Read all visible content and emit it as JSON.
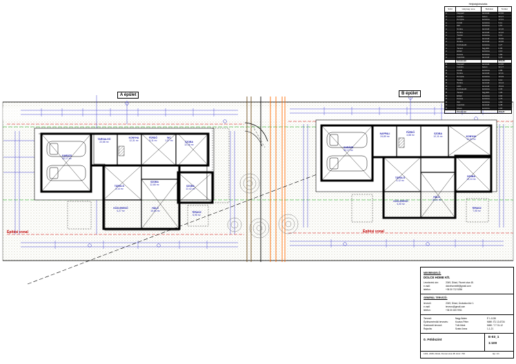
{
  "buildings": {
    "a_label": "A épület",
    "b_label": "B épület",
    "zone_a": "Építési vonal",
    "zone_b": "Építési vonal"
  },
  "rooms_a": [
    {
      "name": "TARSALGÓ",
      "area": "22,66 m²"
    },
    {
      "name": "GARÁZS",
      "area": "32,17 m²"
    },
    {
      "name": "KONYHA",
      "area": "12,31 m²"
    },
    {
      "name": "FÜRDŐ",
      "area": "5,11 m²"
    },
    {
      "name": "WC",
      "area": "1,57 m²"
    },
    {
      "name": "SZOBA",
      "area": "12,16 m²"
    },
    {
      "name": "SZOBA",
      "area": "12,42 m²"
    },
    {
      "name": "TÁROLÓ",
      "area": "3,14 m²"
    },
    {
      "name": "HÁLÓ",
      "area": "15,56 m²"
    },
    {
      "name": "SZOBA",
      "area": "12,66 m²"
    },
    {
      "name": "KÖZLEKEDŐ",
      "area": "4,27 m²"
    },
    {
      "name": "TERASZ",
      "area": "6,95 m²"
    }
  ],
  "rooms_b": [
    {
      "name": "NAPPALI",
      "area": "24,80 m²"
    },
    {
      "name": "GARÁZS",
      "area": "32,17 m²"
    },
    {
      "name": "FÜRDŐ",
      "area": "4,88 m²"
    },
    {
      "name": "SZOBA",
      "area": "12,11 m²"
    },
    {
      "name": "KONYHA",
      "area": "12,04 m²"
    },
    {
      "name": "TÁROLÓ",
      "area": "3,12 m²"
    },
    {
      "name": "SZOBA",
      "area": "13,14 m²"
    },
    {
      "name": "HÁLÓ",
      "area": "15,04 m²"
    },
    {
      "name": "KÖZLEKEDŐ",
      "area": "4,30 m²"
    },
    {
      "name": "TERASZ",
      "area": "7,05 m²"
    }
  ],
  "summary": {
    "title": "Helyiségkimutatás",
    "headers": [
      "Szint",
      "Helyiség neve",
      "Burkolat",
      "Terület"
    ],
    "rows_a": [
      [
        "A",
        "Nappali",
        "laminált",
        "22,66"
      ],
      [
        "A",
        "Garázs",
        "beton",
        "32,17"
      ],
      [
        "A",
        "Konyha",
        "kerámia",
        "12,31"
      ],
      [
        "A",
        "Fürdő",
        "kerámia",
        "5,11"
      ],
      [
        "A",
        "WC",
        "kerámia",
        "1,57"
      ],
      [
        "A",
        "Szoba",
        "laminált",
        "12,16"
      ],
      [
        "A",
        "Szoba",
        "laminált",
        "12,42"
      ],
      [
        "A",
        "Tároló",
        "kerámia",
        "3,14"
      ],
      [
        "A",
        "Háló",
        "laminált",
        "15,56"
      ],
      [
        "A",
        "Szoba",
        "laminált",
        "12,66"
      ],
      [
        "A",
        "Közlekedő",
        "kerámia",
        "4,27"
      ],
      [
        "A",
        "Terasz",
        "fagyálló",
        "6,95"
      ],
      [
        "A",
        "Előtér",
        "kerámia",
        "4,10"
      ],
      [
        "A",
        "Kamra",
        "kerámia",
        "1,82"
      ],
      [
        "A",
        "Gardrób",
        "laminált",
        "3,40"
      ]
    ],
    "total_a": [
      "",
      "Összesen",
      "",
      "150,30"
    ],
    "rows_b": [
      [
        "B",
        "Nappali",
        "laminált",
        "24,80"
      ],
      [
        "B",
        "Garázs",
        "beton",
        "32,17"
      ],
      [
        "B",
        "Fürdő",
        "kerámia",
        "4,88"
      ],
      [
        "B",
        "Szoba",
        "laminált",
        "12,11"
      ],
      [
        "B",
        "Konyha",
        "kerámia",
        "12,04"
      ],
      [
        "B",
        "Tároló",
        "kerámia",
        "3,12"
      ],
      [
        "B",
        "Szoba",
        "laminált",
        "13,14"
      ],
      [
        "B",
        "Háló",
        "laminált",
        "15,04"
      ],
      [
        "B",
        "Közlekedő",
        "kerámia",
        "4,30"
      ],
      [
        "B",
        "Terasz",
        "fagyálló",
        "7,05"
      ],
      [
        "B",
        "Előtér",
        "kerámia",
        "4,02"
      ],
      [
        "B",
        "Kamra",
        "kerámia",
        "1,76"
      ],
      [
        "B",
        "WC",
        "kerámia",
        "1,60"
      ],
      [
        "B",
        "Gardrób",
        "laminált",
        "3,38"
      ],
      [
        "B",
        "Mosó",
        "kerámia",
        "2,90"
      ]
    ],
    "total_b": [
      "",
      "Összesen",
      "",
      "150,31"
    ]
  },
  "titleblock": {
    "s1": "MEGRENDELŐ:",
    "company": "DOLCE HOME Kft.",
    "c1k": "Levelezési cím:",
    "c1v": "2049, Diósd, Fiumei utca 48.",
    "c2k": "e-mail:",
    "c2v": "dolcehomekft@gmail.com",
    "c3k": "telefon:",
    "c3v": "+36 30 712 5296",
    "s2": "GENERÁL TERVEZŐ:",
    "d1k": "tervező:",
    "d1v": "2049, Diósd, Árvácska köz 1.",
    "d2k": "e-mail:",
    "d2v": "tervezo@gmail.com",
    "d3k": "telefon:",
    "d3v": "+36 30 400 9911",
    "e1k": "Tervező:",
    "e1v": "Nagy Ádám",
    "e1r": "É 1-1138",
    "e2k": "Építészmérnöki tervezés:",
    "e2v": "Kovács Péter",
    "e2r": "MMK: É1 13-6734",
    "e3k": "Szerkezeti tervező:",
    "e3v": "Tóth Márk",
    "e3r": "MMK: T-T 01-12",
    "e4k": "Rajzolta:",
    "e4v": "Szabó Anna",
    "e4r": "1-1-21",
    "sheet_name": "0. Földszint",
    "sheet_code": "E-03_1",
    "scale": "1:100",
    "footer": "1191, 2049, Diósd, Fiumei utca 48. Hrsz: 700",
    "footer_r": "lap: 1/1"
  }
}
